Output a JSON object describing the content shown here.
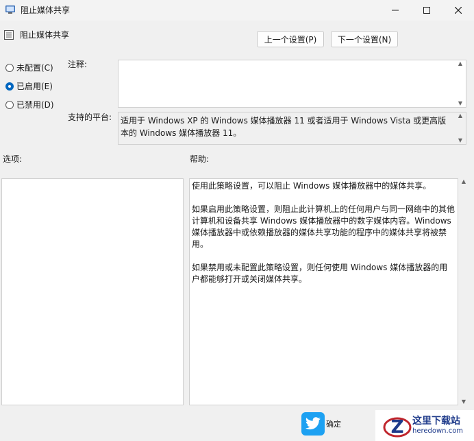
{
  "window": {
    "title": "阻止媒体共享",
    "icon": "group-policy-icon",
    "controls": [
      "minimize-icon",
      "maximize-icon",
      "close-icon"
    ]
  },
  "header": {
    "policy_name": "阻止媒体共享",
    "prev_label": "上一个设置(P)",
    "next_label": "下一个设置(N)"
  },
  "state": {
    "options": [
      {
        "label": "未配置(C)",
        "selected": false
      },
      {
        "label": "已启用(E)",
        "selected": true
      },
      {
        "label": "已禁用(D)",
        "selected": false
      }
    ]
  },
  "comment": {
    "label": "注释:",
    "value": ""
  },
  "platform": {
    "label": "支持的平台:",
    "text": "适用于 Windows XP 的 Windows 媒体播放器 11 或者适用于 Windows Vista 或更高版本的 Windows 媒体播放器 11。"
  },
  "options_label": "选项:",
  "help": {
    "label": "帮助:",
    "paragraphs": [
      "使用此策略设置，可以阻止 Windows 媒体播放器中的媒体共享。",
      "如果启用此策略设置，则阻止此计算机上的任何用户与同一网络中的其他计算机和设备共享 Windows 媒体播放器中的数字媒体内容。Windows 媒体播放器中或依赖播放器的媒体共享功能的程序中的媒体共享将被禁用。",
      "如果禁用或未配置此策略设置，则任何使用 Windows 媒体播放器的用户都能够打开或关闭媒体共享。"
    ]
  },
  "footer": {
    "ok_label": "确定"
  },
  "watermark": {
    "name": "这里下载站",
    "domain": "heredown.com"
  },
  "colors": {
    "accent": "#0067c0",
    "background": "#f0f0f0"
  }
}
